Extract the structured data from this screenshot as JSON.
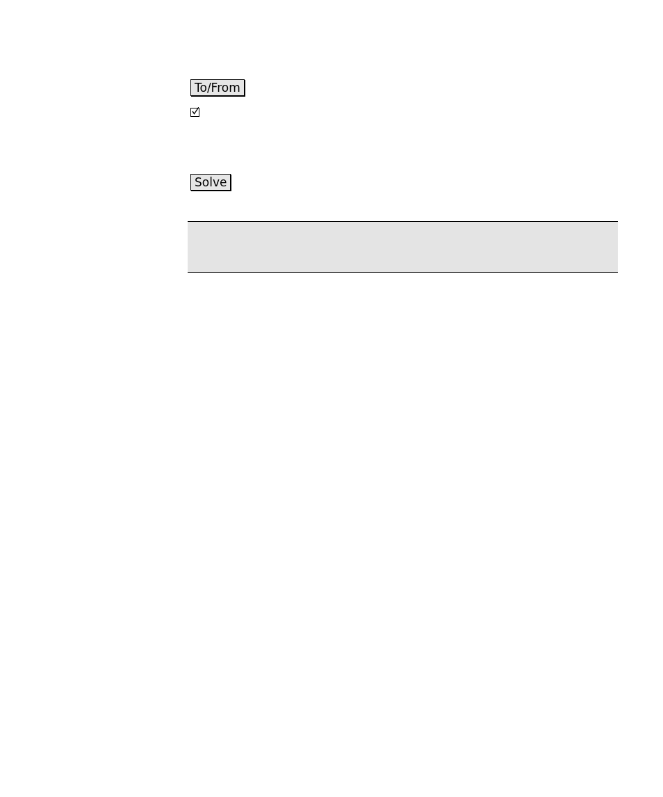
{
  "direction_button": {
    "label": "To/From"
  },
  "option": {
    "checked": true
  },
  "solve_button": {
    "label": "Solve"
  }
}
